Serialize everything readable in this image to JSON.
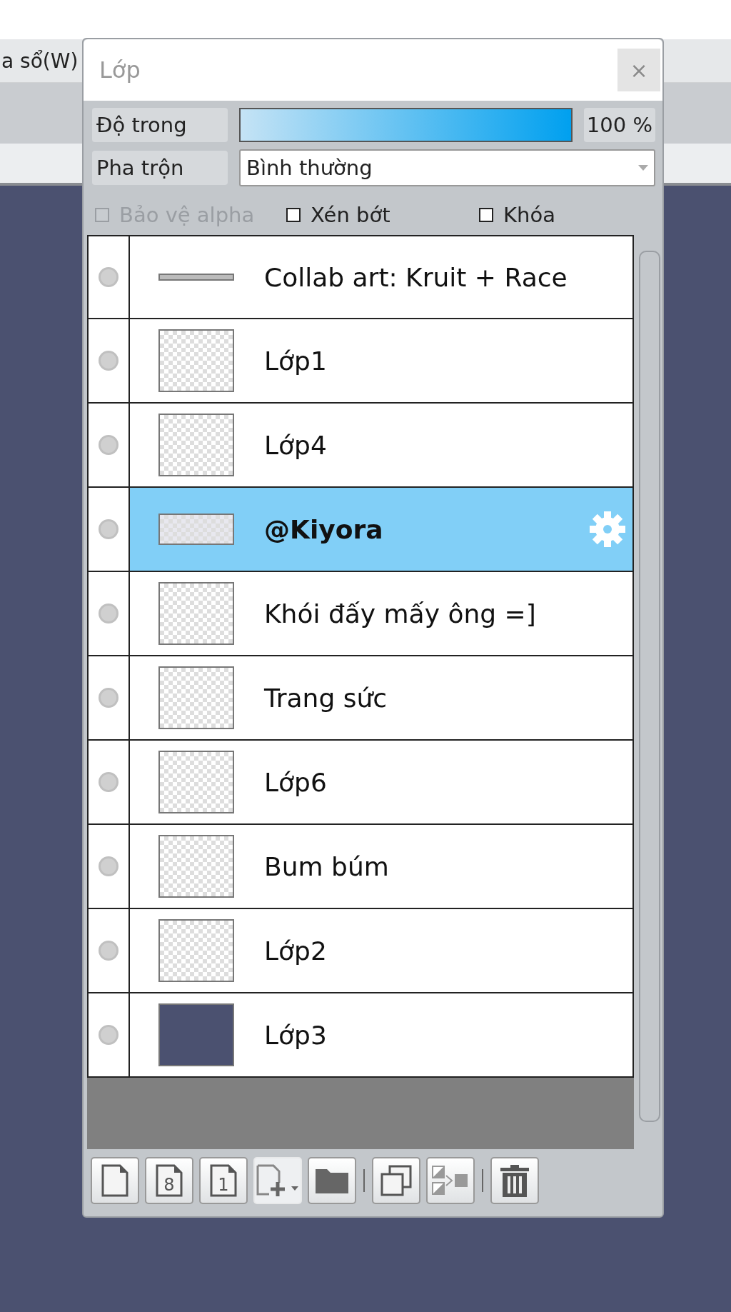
{
  "menu_bar": {
    "item": "a sổ(W)"
  },
  "panel": {
    "title": "Lớp",
    "close": "×",
    "opacity": {
      "label": "Độ trong",
      "level": 1,
      "reading": "100 %"
    },
    "blend": {
      "label": "Pha trộn",
      "value": "Bình thường"
    },
    "options": [
      {
        "label": "Bảo vệ alpha",
        "checked": false,
        "disabled": true
      },
      {
        "label": "Xén bớt",
        "checked": false,
        "disabled": false
      },
      {
        "label": "Khóa",
        "checked": false,
        "disabled": false
      }
    ],
    "layers": [
      {
        "name": "Collab art: Kruit + Race",
        "kind": "strip",
        "selected": false
      },
      {
        "name": "Lớp1",
        "kind": "sketch",
        "selected": false
      },
      {
        "name": "Lớp4",
        "kind": "sketch",
        "selected": false
      },
      {
        "name": "@Kiyora",
        "kind": "text",
        "selected": true
      },
      {
        "name": "Khói đấy mấy ông =]",
        "kind": "transparent",
        "selected": false
      },
      {
        "name": "Trang sức",
        "kind": "transparent",
        "selected": false
      },
      {
        "name": "Lớp6",
        "kind": "blob",
        "selected": false
      },
      {
        "name": "Bum búm",
        "kind": "sketch",
        "selected": false
      },
      {
        "name": "Lớp2",
        "kind": "sketch",
        "selected": false
      },
      {
        "name": "Lớp3",
        "kind": "solid",
        "selected": false
      }
    ],
    "toolbar": [
      {
        "kind": "page"
      },
      {
        "kind": "numbered-page",
        "label": "8"
      },
      {
        "kind": "numbered-page",
        "label": "1"
      },
      {
        "kind": "new-menu"
      },
      {
        "kind": "folder"
      },
      {
        "kind": "separator"
      },
      {
        "kind": "copy"
      },
      {
        "kind": "merge"
      },
      {
        "kind": "separator"
      },
      {
        "kind": "trash"
      }
    ]
  }
}
